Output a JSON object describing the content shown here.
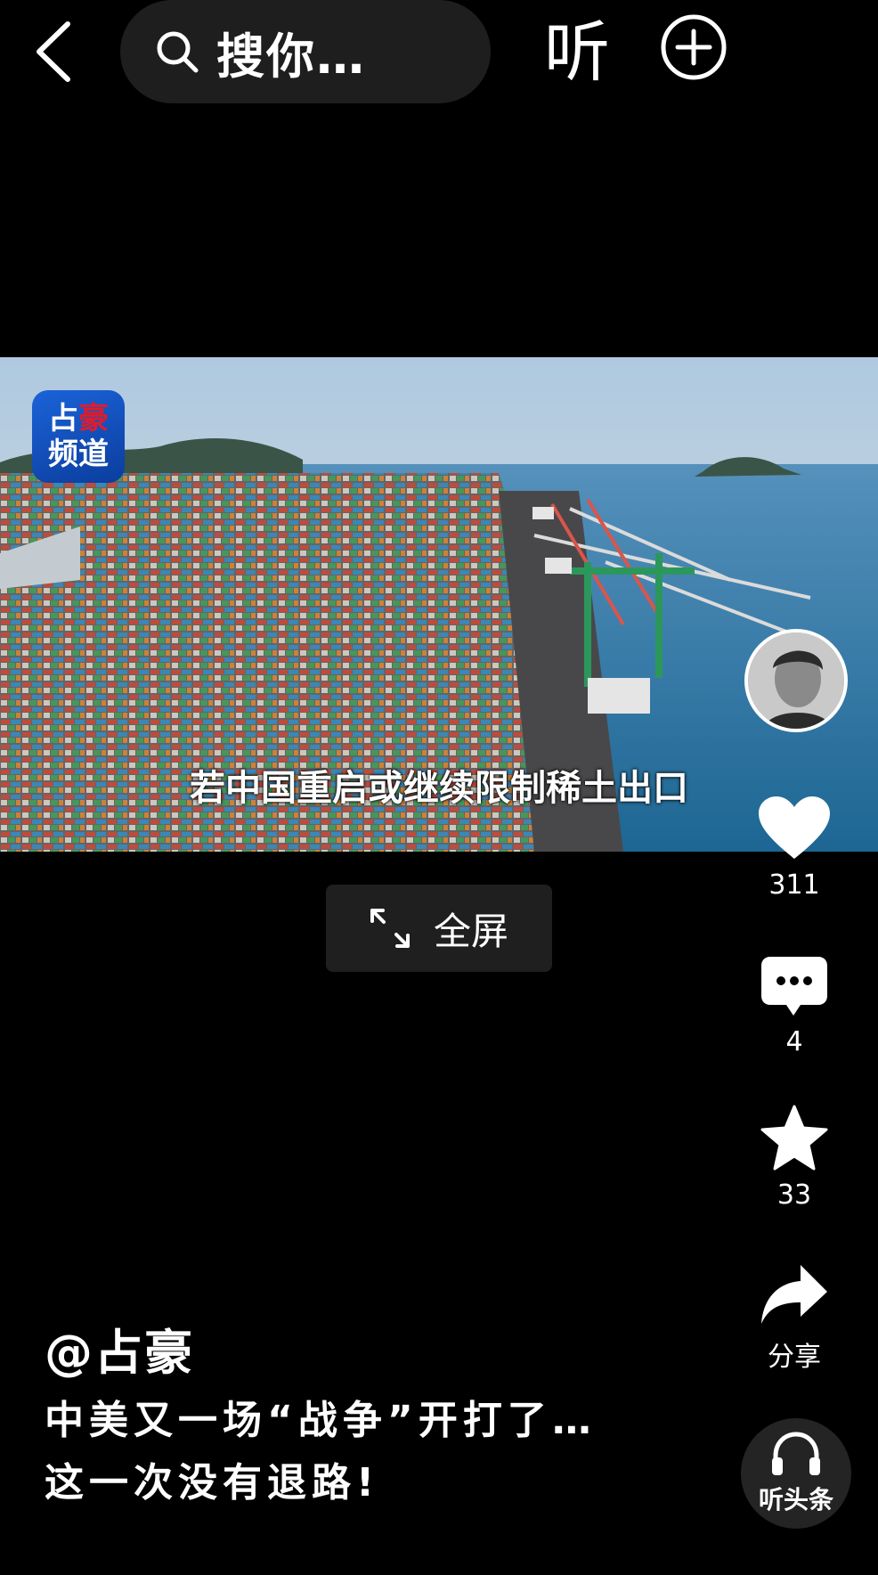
{
  "header": {
    "search_placeholder": "搜你…",
    "listen_label": "听"
  },
  "video": {
    "channel_logo_line1": "占",
    "channel_logo_line1_red": "豪",
    "channel_logo_line2": "频道",
    "subtitle": "若中国重启或继续限制稀土出口"
  },
  "fullscreen": {
    "label": "全屏"
  },
  "rail": {
    "like_count": "311",
    "comment_count": "4",
    "favorite_count": "33",
    "share_label": "分享",
    "listen_bar_label": "听头条"
  },
  "post": {
    "author": "@占豪",
    "caption_line1": "中美又一场“战争”开打了…",
    "caption_line2": "这一次没有退路!"
  },
  "colors": {
    "background": "#000000",
    "search_bg": "#1e1e1e",
    "logo_blue": "#1b63d8",
    "logo_red": "#e21b2a"
  }
}
